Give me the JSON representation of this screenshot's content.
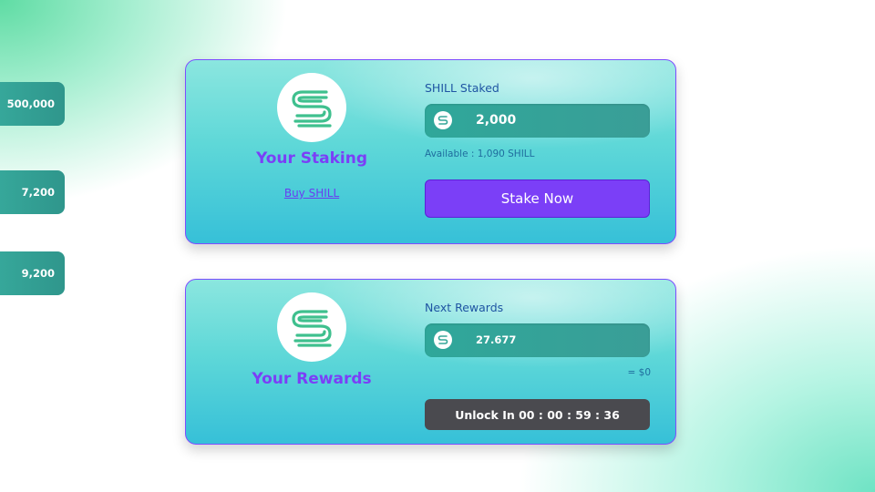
{
  "side_tabs": [
    "500,000",
    "7,200",
    "9,200"
  ],
  "staking": {
    "title": "Your Staking",
    "buy_link": "Buy SHILL",
    "field_label": "SHILL Staked",
    "amount": "2,000",
    "available": "Available : 1,090 SHILL",
    "stake_button": "Stake Now"
  },
  "rewards": {
    "title": "Your Rewards",
    "field_label": "Next Rewards",
    "amount": "27.677",
    "usd_value": "= $0",
    "unlock_button": "Unlock In 00 : 00 : 59 : 36"
  },
  "colors": {
    "accent": "#7b3ff7",
    "field": "#2fa79a",
    "unlock_button": "#4a4a4f",
    "logo_stripes": "#3fc08e"
  },
  "icons": [
    "shill-logo-icon",
    "shill-token-icon"
  ]
}
